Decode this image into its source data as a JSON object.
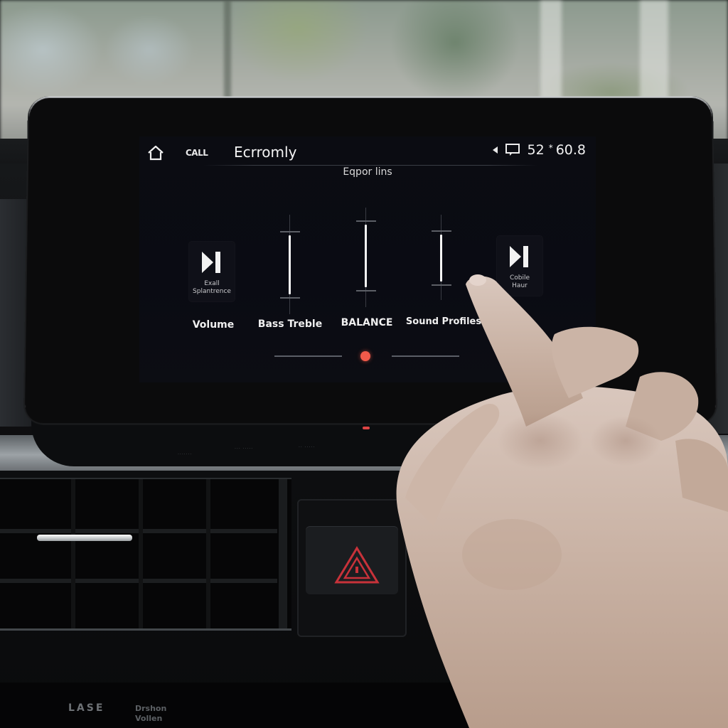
{
  "screen": {
    "status_bar": {
      "home_icon": "home-icon",
      "call_label": "CALL",
      "app_title": "Ecrromly",
      "back_icon": "back-triangle-icon",
      "message_icon": "message-icon",
      "left_value": "52",
      "separator": "*",
      "right_value": "60.8"
    },
    "subtitle": "Eqpor lins",
    "left_tile": {
      "icon": "skip-next-icon",
      "caption_line1": "Exall",
      "caption_line2": "Splantrence"
    },
    "right_tile": {
      "icon": "skip-next-icon",
      "caption_line1": "Cobile",
      "caption_line2": "Haur"
    },
    "sliders": [
      {
        "name": "bass-treble",
        "level_fraction": 0.5
      },
      {
        "name": "balance",
        "level_fraction": 0.62
      },
      {
        "name": "sound-profiles",
        "level_fraction": 0.45
      }
    ],
    "labels": [
      "Volume",
      "Bass Treble",
      "BALANCE",
      "Sound Profiles"
    ],
    "pager": {
      "active_index": 1,
      "accent_color": "#f25a4a"
    }
  },
  "dashboard": {
    "hazard_icon": "hazard-triangle-icon",
    "hazard_color": "#c8323a",
    "bottom_labels": [
      "LASE",
      "Drshon",
      "Vollen"
    ]
  }
}
